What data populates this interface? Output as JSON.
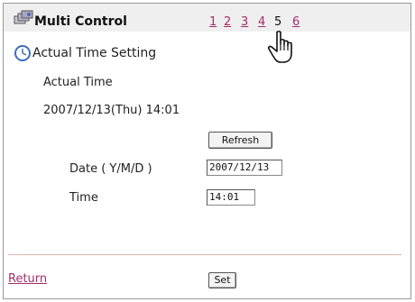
{
  "header": {
    "title": "Multi Control",
    "pages": [
      "1",
      "2",
      "3",
      "4",
      "5",
      "6"
    ],
    "current_page": "5"
  },
  "section": {
    "title": "Actual Time Setting"
  },
  "actual_time": {
    "label": "Actual Time",
    "value": "2007/12/13(Thu) 14:01"
  },
  "refresh_button": "Refresh",
  "form": {
    "date_label": "Date ( Y/M/D )",
    "date_value": "2007/12/13",
    "time_label": "Time",
    "time_value": "14:01"
  },
  "footer": {
    "return_link": "Return",
    "set_button": "Set"
  },
  "colors": {
    "link": "#a0306a",
    "header_bg": "#efefef"
  }
}
